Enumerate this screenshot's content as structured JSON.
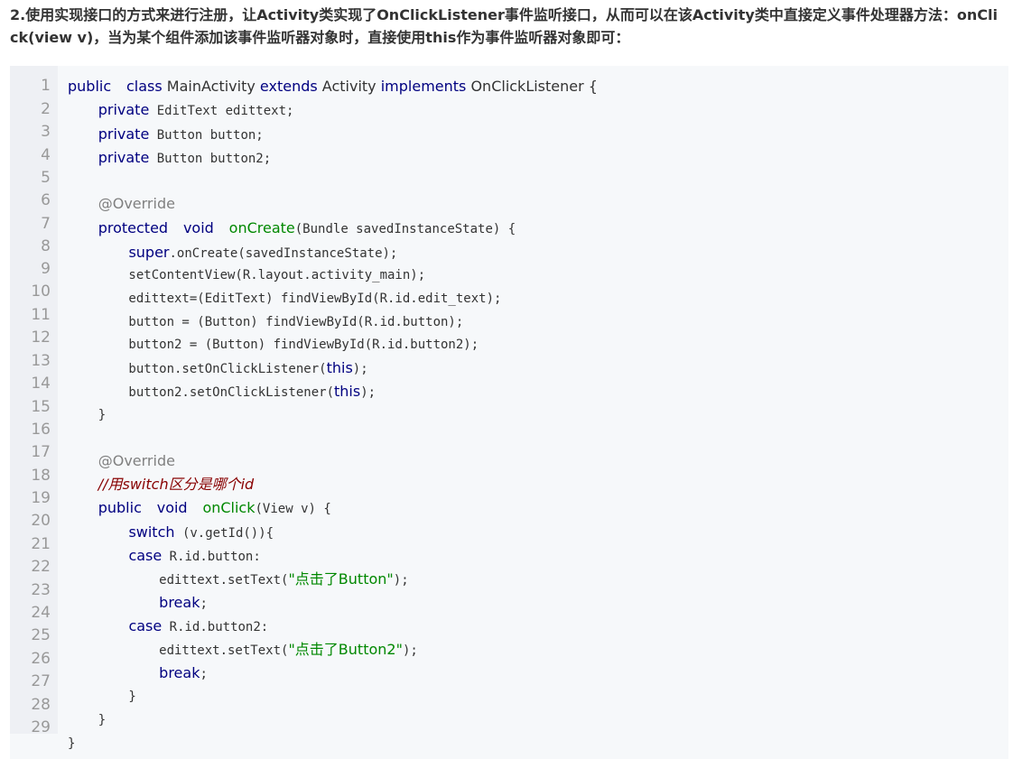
{
  "heading": "2.使用实现接口的方式来进行注册，让Activity类实现了OnClickListener事件监听接口，从而可以在该Activity类中直接定义事件处理器方法：onClick(view v)，当为某个组件添加该事件监听器对象时，直接使用this作为事件监听器对象即可：",
  "line_numbers": [
    "1",
    "2",
    "3",
    "4",
    "5",
    "6",
    "7",
    "8",
    "9",
    "10",
    "11",
    "12",
    "13",
    "14",
    "15",
    "16",
    "17",
    "18",
    "19",
    "20",
    "21",
    "22",
    "23",
    "24",
    "25",
    "26",
    "27",
    "28",
    "29"
  ],
  "code_lines": [
    [
      [
        "kw",
        "public"
      ],
      [
        "",
        "  "
      ],
      [
        "kw",
        "class"
      ],
      [
        "",
        ""
      ],
      [
        "cls",
        " MainActivity "
      ],
      [
        "kw",
        "extends"
      ],
      [
        "cls",
        " Activity "
      ],
      [
        "kw",
        "implements"
      ],
      [
        "cls",
        " OnClickListener {"
      ]
    ],
    [
      [
        "",
        "    "
      ],
      [
        "kw",
        "private"
      ],
      [
        "",
        " EditText edittext;"
      ]
    ],
    [
      [
        "",
        "    "
      ],
      [
        "kw",
        "private"
      ],
      [
        "",
        " Button button;"
      ]
    ],
    [
      [
        "",
        "    "
      ],
      [
        "kw",
        "private"
      ],
      [
        "",
        " Button button2;"
      ]
    ],
    [],
    [
      [
        "",
        "    "
      ],
      [
        "ann",
        "@Override"
      ]
    ],
    [
      [
        "",
        "    "
      ],
      [
        "kw",
        "protected"
      ],
      [
        "",
        "  "
      ],
      [
        "kw",
        "void"
      ],
      [
        "",
        "  "
      ],
      [
        "fn",
        "onCreate"
      ],
      [
        "",
        "(Bundle savedInstanceState) {"
      ]
    ],
    [
      [
        "",
        "        "
      ],
      [
        "kw",
        "super"
      ],
      [
        "",
        ".onCreate(savedInstanceState);"
      ]
    ],
    [
      [
        "",
        "        setContentView(R.layout.activity_main);"
      ]
    ],
    [
      [
        "",
        "        edittext=(EditText) findViewById(R.id.edit_text);"
      ]
    ],
    [
      [
        "",
        "        button = (Button) findViewById(R.id.button);"
      ]
    ],
    [
      [
        "",
        "        button2 = (Button) findViewById(R.id.button2);"
      ]
    ],
    [
      [
        "",
        "        button.setOnClickListener("
      ],
      [
        "kw",
        "this"
      ],
      [
        "",
        ");"
      ]
    ],
    [
      [
        "",
        "        button2.setOnClickListener("
      ],
      [
        "kw",
        "this"
      ],
      [
        "",
        ");"
      ]
    ],
    [
      [
        "",
        "    }"
      ]
    ],
    [],
    [
      [
        "",
        "    "
      ],
      [
        "ann",
        "@Override"
      ]
    ],
    [
      [
        "",
        "    "
      ],
      [
        "cm",
        "//用switch区分是哪个id"
      ]
    ],
    [
      [
        "",
        "    "
      ],
      [
        "kw",
        "public"
      ],
      [
        "",
        "  "
      ],
      [
        "kw",
        "void"
      ],
      [
        "",
        "  "
      ],
      [
        "fn",
        "onClick"
      ],
      [
        "",
        "(View v) {"
      ]
    ],
    [
      [
        "",
        "        "
      ],
      [
        "kw",
        "switch"
      ],
      [
        "",
        " (v.getId()){"
      ]
    ],
    [
      [
        "",
        "        "
      ],
      [
        "kw",
        "case"
      ],
      [
        "",
        " R.id.button:"
      ]
    ],
    [
      [
        "",
        "            edittext.setText("
      ],
      [
        "str",
        "\"点击了Button\""
      ],
      [
        "",
        ");"
      ]
    ],
    [
      [
        "",
        "            "
      ],
      [
        "kw",
        "break"
      ],
      [
        "",
        ";"
      ]
    ],
    [
      [
        "",
        "        "
      ],
      [
        "kw",
        "case"
      ],
      [
        "",
        " R.id.button2:"
      ]
    ],
    [
      [
        "",
        "            edittext.setText("
      ],
      [
        "str",
        "\"点击了Button2\""
      ],
      [
        "",
        ");"
      ]
    ],
    [
      [
        "",
        "            "
      ],
      [
        "kw",
        "break"
      ],
      [
        "",
        ";"
      ]
    ],
    [
      [
        "",
        "        }"
      ]
    ],
    [
      [
        "",
        "    }"
      ]
    ],
    [
      [
        "",
        "}"
      ]
    ]
  ]
}
